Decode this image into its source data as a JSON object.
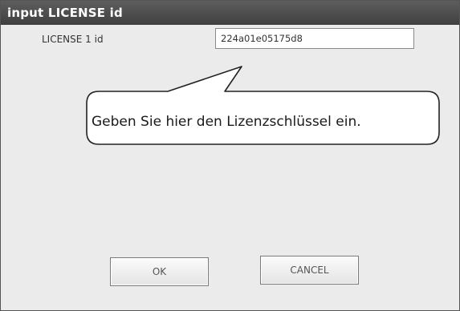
{
  "window": {
    "title": "input LICENSE id"
  },
  "form": {
    "license_label": "LICENSE 1 id",
    "license_value": "224a01e05175d8"
  },
  "callout": {
    "text": "Geben Sie hier den Lizenzschlüssel ein."
  },
  "buttons": {
    "ok_label": "OK",
    "cancel_label": "CANCEL"
  },
  "colors": {
    "titlebar": "#4a4a4a",
    "dialog_background": "#ebebeb",
    "callout_background": "#ffffff"
  }
}
